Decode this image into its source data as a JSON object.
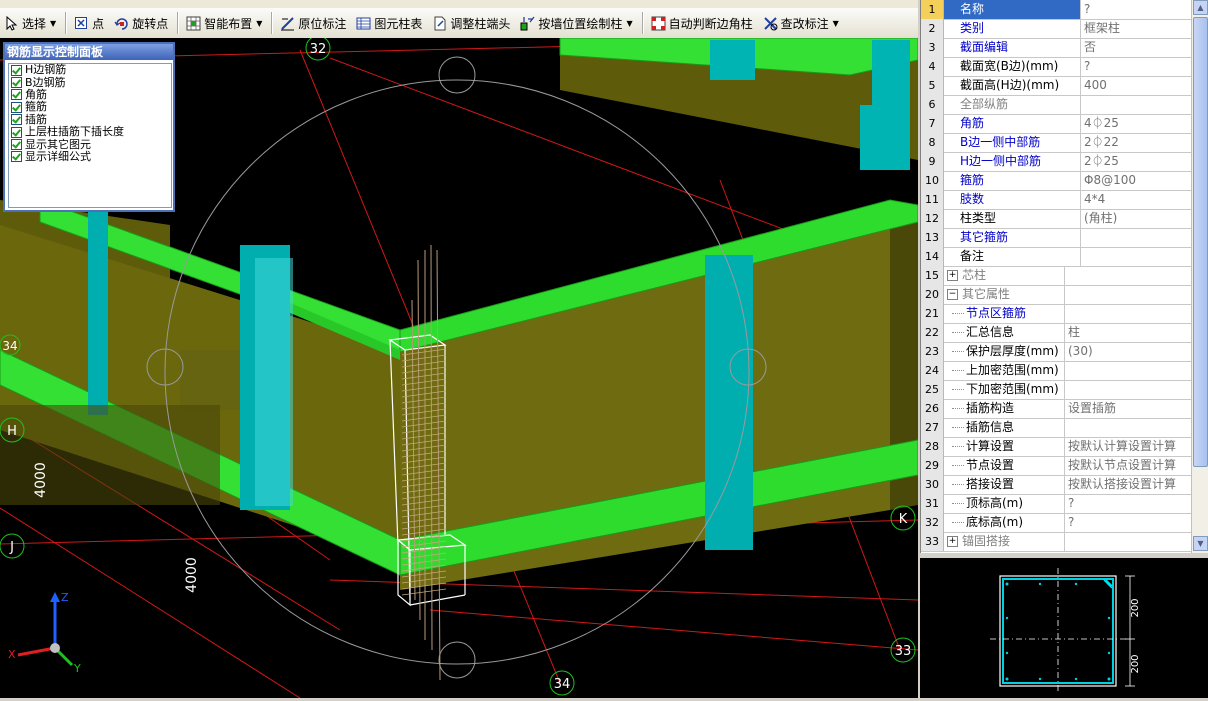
{
  "toolbar": {
    "items": [
      {
        "label": "选择",
        "icon": "cursor-icon",
        "dropdown": true
      },
      {
        "label": "点",
        "icon": "point-icon"
      },
      {
        "label": "旋转点",
        "icon": "rotate-point-icon"
      },
      {
        "label": "智能布置",
        "icon": "smart-layout-icon",
        "dropdown": true
      },
      {
        "label": "原位标注",
        "icon": "in-place-annotation-icon"
      },
      {
        "label": "图元柱表",
        "icon": "column-table-icon"
      },
      {
        "label": "调整柱端头",
        "icon": "adjust-column-end-icon"
      },
      {
        "label": "按墙位置绘制柱",
        "icon": "draw-by-wall-icon",
        "dropdown": true
      },
      {
        "label": "自动判断边角柱",
        "icon": "auto-corner-column-icon"
      },
      {
        "label": "查改标注",
        "icon": "edit-annotation-icon",
        "dropdown": true
      }
    ]
  },
  "control_panel": {
    "title": "钢筋显示控制面板",
    "items": [
      "H边钢筋",
      "B边钢筋",
      "角筋",
      "箍筋",
      "插筋",
      "上层柱插筋下插长度",
      "显示其它图元",
      "显示详细公式"
    ]
  },
  "viewport": {
    "axis_labels": {
      "a32": "32",
      "a34_top": "34",
      "a33": "33",
      "a34": "34",
      "H": "H",
      "J": "J",
      "K": "K"
    },
    "dimensions": [
      "4000",
      "4000"
    ],
    "axes": {
      "x": "X",
      "y": "Y",
      "z": "Z"
    }
  },
  "properties": {
    "rows": [
      {
        "num": "1",
        "name": "名称",
        "value": "?",
        "style": "blue",
        "selected": true
      },
      {
        "num": "2",
        "name": "类别",
        "value": "框架柱",
        "style": "blue"
      },
      {
        "num": "3",
        "name": "截面编辑",
        "value": "否",
        "style": "blue"
      },
      {
        "num": "4",
        "name": "截面宽(B边)(mm)",
        "value": "?",
        "style": "normal"
      },
      {
        "num": "5",
        "name": "截面高(H边)(mm)",
        "value": "400",
        "style": "normal"
      },
      {
        "num": "6",
        "name": "全部纵筋",
        "value": "",
        "style": "gray"
      },
      {
        "num": "7",
        "name": "角筋",
        "value": "4⏀25",
        "style": "blue"
      },
      {
        "num": "8",
        "name": "B边一侧中部筋",
        "value": "2⏀22",
        "style": "blue"
      },
      {
        "num": "9",
        "name": "H边一侧中部筋",
        "value": "2⏀25",
        "style": "blue"
      },
      {
        "num": "10",
        "name": "箍筋",
        "value": "Φ8@100",
        "style": "blue"
      },
      {
        "num": "11",
        "name": "肢数",
        "value": "4*4",
        "style": "blue"
      },
      {
        "num": "12",
        "name": "柱类型",
        "value": "(角柱)",
        "style": "normal"
      },
      {
        "num": "13",
        "name": "其它箍筋",
        "value": "",
        "style": "blue"
      },
      {
        "num": "14",
        "name": "备注",
        "value": "",
        "style": "normal"
      },
      {
        "num": "15",
        "name": "芯柱",
        "value": "",
        "style": "gray",
        "expander": "+"
      },
      {
        "num": "20",
        "name": "其它属性",
        "value": "",
        "style": "gray",
        "expander": "−"
      },
      {
        "num": "21",
        "name": "节点区箍筋",
        "value": "",
        "style": "blue",
        "child": true
      },
      {
        "num": "22",
        "name": "汇总信息",
        "value": "柱",
        "style": "normal",
        "child": true
      },
      {
        "num": "23",
        "name": "保护层厚度(mm)",
        "value": "(30)",
        "style": "normal",
        "child": true
      },
      {
        "num": "24",
        "name": "上加密范围(mm)",
        "value": "",
        "style": "normal",
        "child": true
      },
      {
        "num": "25",
        "name": "下加密范围(mm)",
        "value": "",
        "style": "normal",
        "child": true
      },
      {
        "num": "26",
        "name": "插筋构造",
        "value": "设置插筋",
        "style": "normal",
        "child": true
      },
      {
        "num": "27",
        "name": "插筋信息",
        "value": "",
        "style": "normal",
        "child": true
      },
      {
        "num": "28",
        "name": "计算设置",
        "value": "按默认计算设置计算",
        "style": "normal",
        "child": true
      },
      {
        "num": "29",
        "name": "节点设置",
        "value": "按默认节点设置计算",
        "style": "normal",
        "child": true
      },
      {
        "num": "30",
        "name": "搭接设置",
        "value": "按默认搭接设置计算",
        "style": "normal",
        "child": true
      },
      {
        "num": "31",
        "name": "顶标高(m)",
        "value": "?",
        "style": "normal",
        "child": true
      },
      {
        "num": "32",
        "name": "底标高(m)",
        "value": "?",
        "style": "normal",
        "child": true
      },
      {
        "num": "33",
        "name": "锚固搭接",
        "value": "",
        "style": "gray",
        "expander": "+"
      }
    ]
  },
  "preview": {
    "dim_top": "200",
    "dim_bottom": "200"
  },
  "colors": {
    "beam": "#2ee02e",
    "wall": "#6e6b0d",
    "column": "#00b4b4",
    "grid": "#e01010"
  }
}
